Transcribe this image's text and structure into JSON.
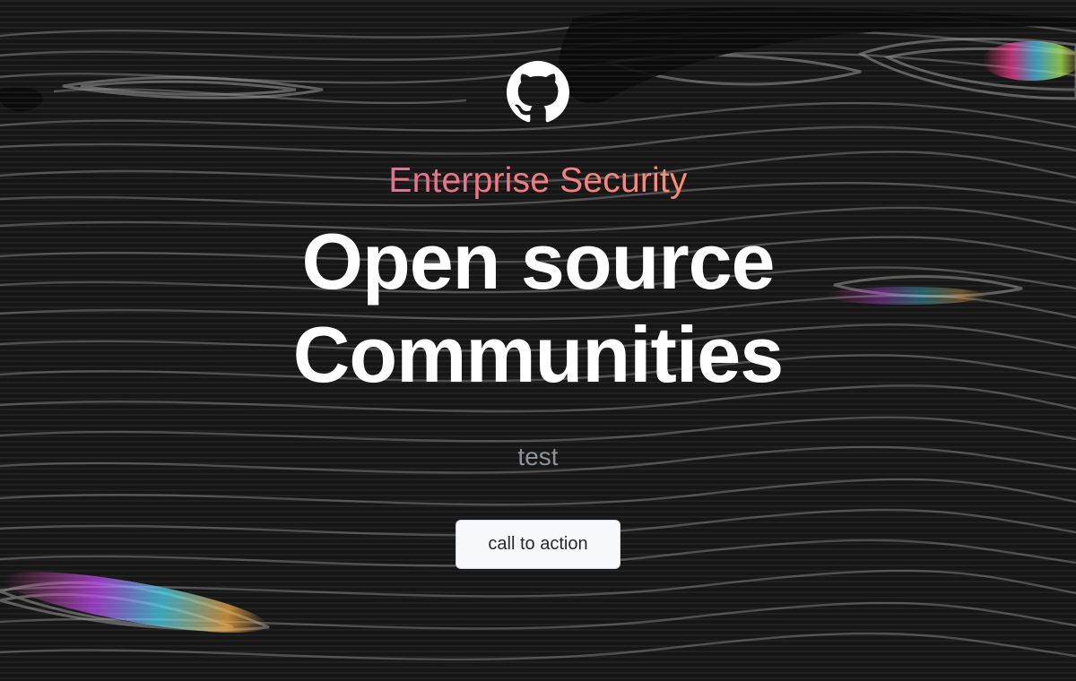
{
  "hero": {
    "logo_icon": "github-octocat-icon",
    "eyebrow": "Enterprise Security",
    "headline_line1": "Open source",
    "headline_line2": "Communities",
    "subtext": "test",
    "cta_label": "call to action"
  },
  "colors": {
    "background": "#141414",
    "eyebrow_gradient_start": "#ec6e8c",
    "eyebrow_gradient_end": "#fd8c73",
    "headline": "#ffffff",
    "subtext": "#8b949e",
    "cta_background": "#f6f8fa",
    "cta_text": "#24292f"
  }
}
